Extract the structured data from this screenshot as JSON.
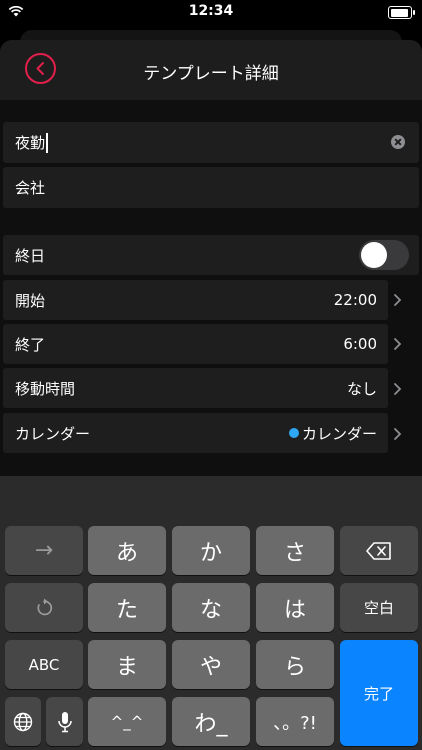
{
  "status": {
    "time": "12:34"
  },
  "nav": {
    "title": "テンプレート詳細"
  },
  "fields": {
    "title_value": "夜勤",
    "location_value": "会社"
  },
  "rows": {
    "all_day": {
      "label": "終日",
      "on": false
    },
    "start": {
      "label": "開始",
      "value": "22:00"
    },
    "end": {
      "label": "終了",
      "value": "6:00"
    },
    "travel": {
      "label": "移動時間",
      "value": "なし"
    },
    "calendar": {
      "label": "カレンダー",
      "value": "カレンダー",
      "color": "#2ea7f5"
    }
  },
  "keyboard": {
    "arrow": "→",
    "a": "あ",
    "ka": "か",
    "sa": "さ",
    "ta": "た",
    "na": "な",
    "ha": "は",
    "space": "空白",
    "abc": "ABC",
    "ma": "ま",
    "ya": "や",
    "ra": "ら",
    "done": "完了",
    "emoticon": "^_^",
    "wa": "わ_",
    "punct": "、。?!"
  },
  "colors": {
    "accent": "#e11f4b",
    "done": "#0a84ff"
  }
}
